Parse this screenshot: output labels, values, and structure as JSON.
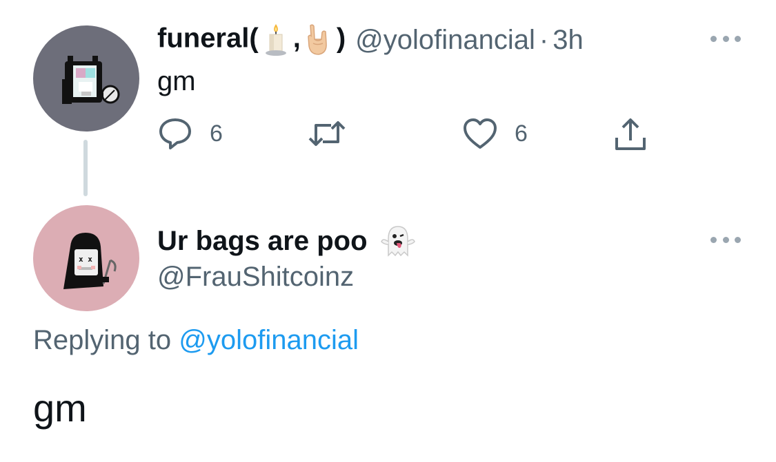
{
  "tweet1": {
    "display_name_prefix": "funeral(",
    "display_name_comma": ",",
    "display_name_suffix": ")",
    "emojis": [
      "candle-icon",
      "sign-of-the-horns-icon"
    ],
    "handle": "@yolofinancial",
    "separator": "·",
    "timestamp": "3h",
    "text": "gm",
    "actions": {
      "reply_count": "6",
      "like_count": "6"
    },
    "avatar_icon": "pixel-creature-avatar"
  },
  "tweet2": {
    "display_name": "Ur bags are poo",
    "name_emoji": "ghost-tongue-icon",
    "handle": "@FrauShitcoinz",
    "replying_label": "Replying to",
    "replying_mention": "@yolofinancial",
    "text": "gm",
    "avatar_icon": "pixel-skull-avatar"
  },
  "colors": {
    "primary_text": "#0f1419",
    "secondary_text": "#536471",
    "link": "#1d9bf0",
    "thread_line": "#cfd9de",
    "avatar1_bg": "#6d6e7a",
    "avatar2_bg": "#dcadb4"
  }
}
